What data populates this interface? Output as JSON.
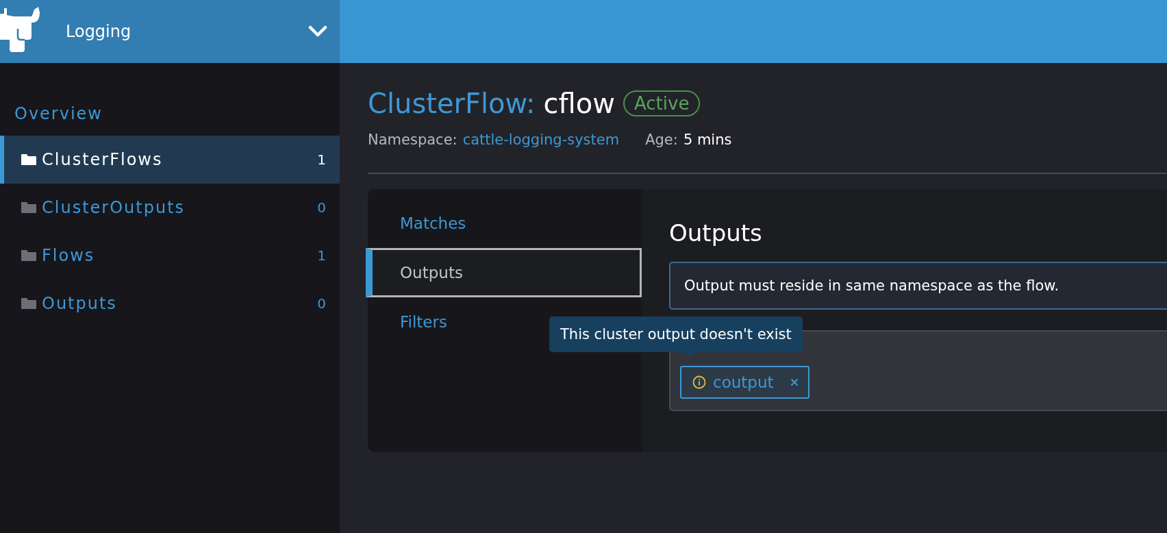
{
  "header": {
    "title": "Logging"
  },
  "sidebar": {
    "heading": "Overview",
    "items": [
      {
        "label": "ClusterFlows",
        "count": "1",
        "selected": true
      },
      {
        "label": "ClusterOutputs",
        "count": "0",
        "selected": false
      },
      {
        "label": "Flows",
        "count": "1",
        "selected": false
      },
      {
        "label": "Outputs",
        "count": "0",
        "selected": false
      }
    ]
  },
  "resource": {
    "kind": "ClusterFlow:",
    "name": "cflow",
    "status": "Active",
    "namespace_label": "Namespace:",
    "namespace": "cattle-logging-system",
    "age_label": "Age:",
    "age": "5 mins"
  },
  "tabs": [
    {
      "label": "Matches",
      "selected": false
    },
    {
      "label": "Outputs",
      "selected": true
    },
    {
      "label": "Filters",
      "selected": false
    }
  ],
  "section": {
    "title": "Outputs",
    "info": "Output must reside in same namespace as the flow.",
    "tooltip": "This cluster output doesn't exist",
    "outputs": [
      {
        "label": "coutput",
        "warning": true
      }
    ]
  }
}
